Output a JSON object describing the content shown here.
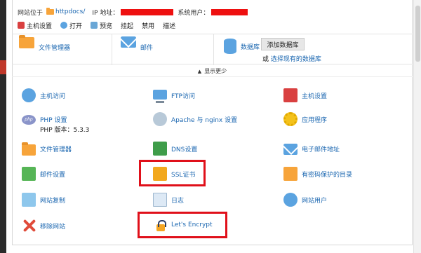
{
  "header": {
    "site_label": "网站位于",
    "site_path": "httpdocs/",
    "ip_label": "IP 地址：",
    "sysuser_label": "系统用户："
  },
  "toolbar": [
    {
      "label": "主机设置",
      "icon": "hosting-settings-icon"
    },
    {
      "label": "打开",
      "icon": "open-globe-icon"
    },
    {
      "label": "预览",
      "icon": "preview-icon"
    },
    {
      "label": "挂起",
      "icon": ""
    },
    {
      "label": "禁用",
      "icon": ""
    },
    {
      "label": "描述",
      "icon": ""
    }
  ],
  "tiles": {
    "file_manager": "文件管理器",
    "mail": "邮件",
    "database": "数据库",
    "add_database": "添加数据库",
    "or": "或",
    "select_existing": "选择现有的数据库"
  },
  "show_less": "显示更少",
  "items": [
    {
      "label": "主机访问",
      "icon": "hosting-access-icon"
    },
    {
      "label": "FTP访问",
      "icon": "ftp-access-icon"
    },
    {
      "label": "主机设置",
      "icon": "hosting-settings-icon"
    },
    {
      "label": "PHP 设置",
      "icon": "php-icon",
      "sub": "PHP 版本：5.3.3"
    },
    {
      "label": "Apache 与 nginx 设置",
      "icon": "apache-nginx-icon"
    },
    {
      "label": "应用程序",
      "icon": "applications-gear-icon"
    },
    {
      "label": "文件管理器",
      "icon": "folder-icon"
    },
    {
      "label": "DNS设置",
      "icon": "dns-icon"
    },
    {
      "label": "电子邮件地址",
      "icon": "email-address-icon"
    },
    {
      "label": "邮件设置",
      "icon": "mail-settings-icon"
    },
    {
      "label": "SSL证书",
      "icon": "ssl-certificate-icon"
    },
    {
      "label": "有密码保护的目录",
      "icon": "password-protected-folder-icon"
    },
    {
      "label": "网站复制",
      "icon": "website-copy-icon"
    },
    {
      "label": "日志",
      "icon": "logs-icon"
    },
    {
      "label": "网站用户",
      "icon": "web-users-icon"
    },
    {
      "label": "移除网站",
      "icon": "remove-website-icon"
    },
    {
      "label": "Let's Encrypt",
      "icon": "lets-encrypt-lock-icon"
    }
  ],
  "colors": {
    "link": "#1a66b0",
    "highlight": "#e0101a",
    "redaction": "#ee1010"
  }
}
